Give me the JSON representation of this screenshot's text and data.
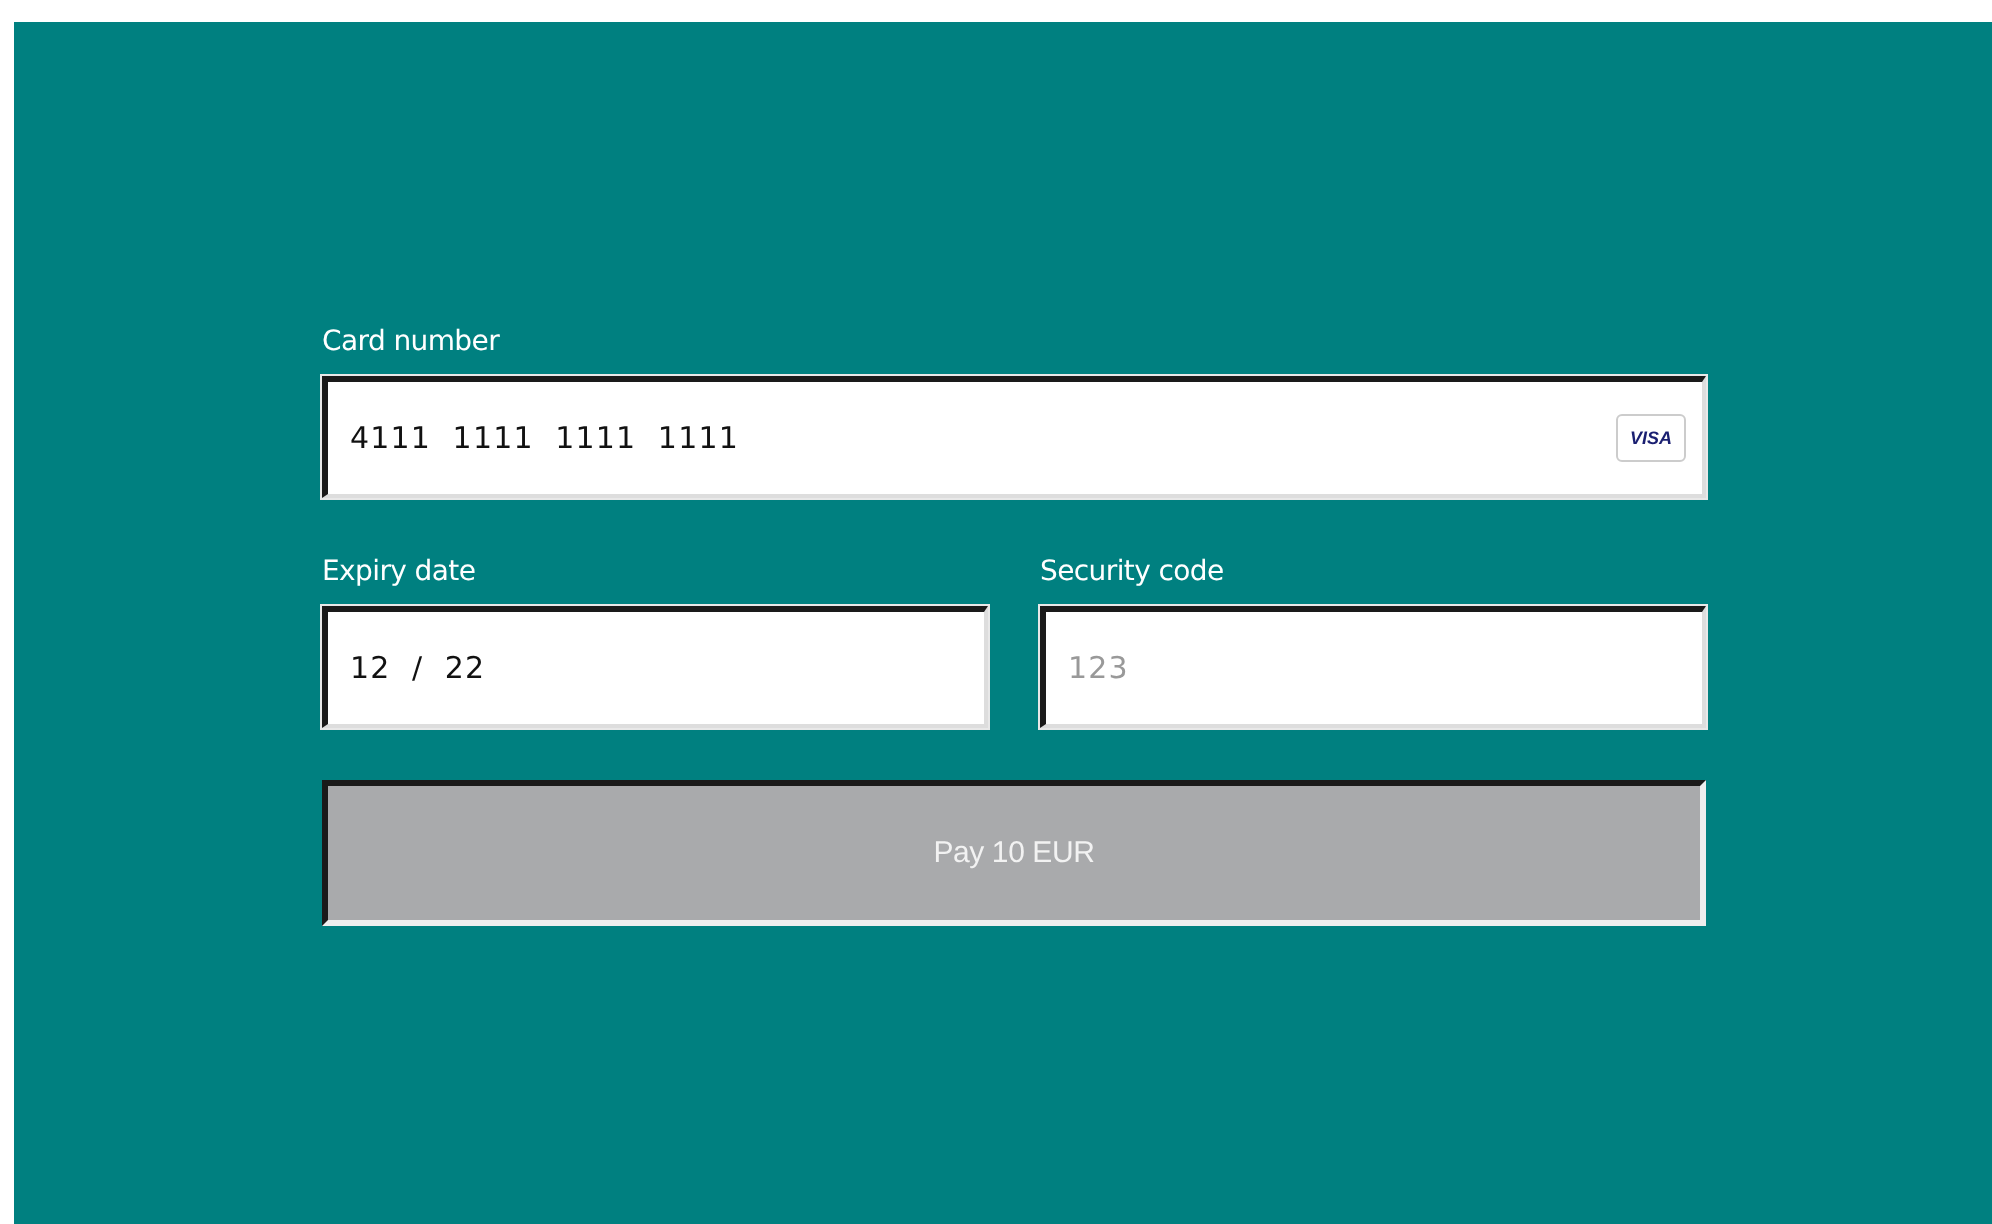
{
  "card_number": {
    "label": "Card number",
    "value": "4111  1111  1111  1111",
    "brand": "VISA"
  },
  "expiry_date": {
    "label": "Expiry date",
    "value": "12  /  22"
  },
  "security_code": {
    "label": "Security code",
    "placeholder": "123"
  },
  "pay_button": {
    "label": "Pay 10 EUR",
    "disabled": true
  }
}
